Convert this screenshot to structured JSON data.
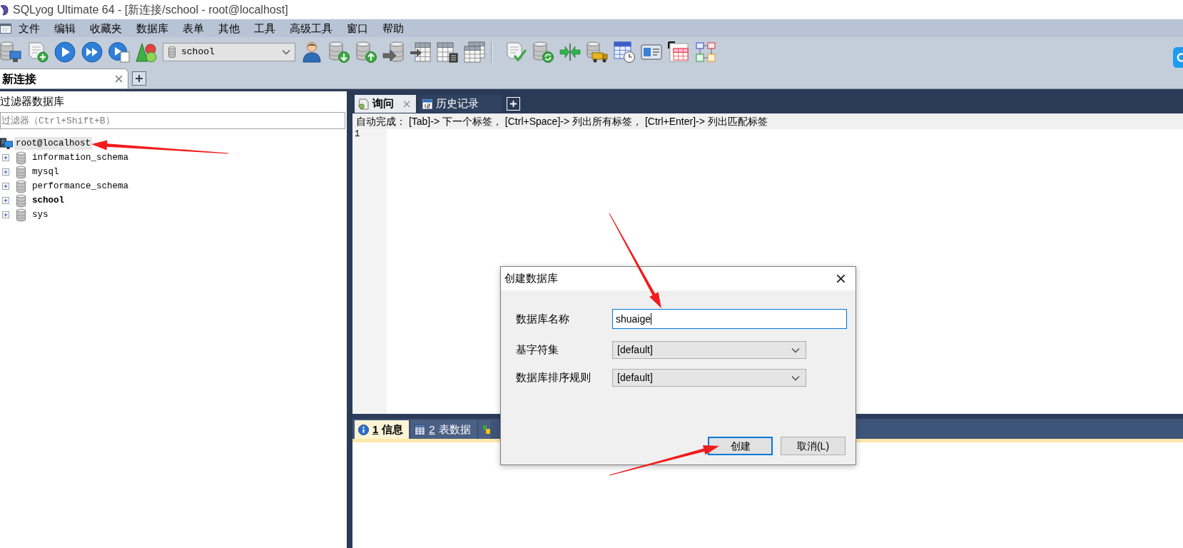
{
  "window": {
    "title": "SQLyog Ultimate 64 - [新连接/school - root@localhost]"
  },
  "menu": [
    "文件",
    "编辑",
    "收藏夹",
    "数据库",
    "表单",
    "其他",
    "工具",
    "高级工具",
    "窗口",
    "帮助"
  ],
  "toolbar": {
    "database": "school"
  },
  "connection_tabs": [
    {
      "label": "新连接",
      "selected": true
    }
  ],
  "object_browser": {
    "title": "过滤器数据库",
    "filter": {
      "placeholder": "过滤器（Ctrl+Shift+B）"
    },
    "tree": [
      {
        "kind": "server",
        "label": "root@localhost",
        "selected": true,
        "children": [
          {
            "kind": "database",
            "label": "information_schema",
            "selected": false,
            "current": false,
            "expanded": false
          },
          {
            "kind": "database",
            "label": "mysql",
            "selected": false,
            "current": false,
            "expanded": false
          },
          {
            "kind": "database",
            "label": "performance_schema",
            "selected": false,
            "current": false,
            "expanded": false
          },
          {
            "kind": "database",
            "label": "school",
            "selected": false,
            "current": true,
            "expanded": false
          },
          {
            "kind": "database",
            "label": "sys",
            "selected": false,
            "current": false,
            "expanded": false
          }
        ]
      }
    ]
  },
  "query_tabs": [
    {
      "kind": "query",
      "label": "询问",
      "selected": true
    },
    {
      "kind": "history",
      "label": "历史记录",
      "selected": false
    }
  ],
  "autocomplete_hint": "自动完成： [Tab]-> 下一个标签， [Ctrl+Space]-> 列出所有标签， [Ctrl+Enter]-> 列出匹配标签",
  "editor": {
    "line_numbers": [
      "1"
    ]
  },
  "result_tabs": [
    {
      "kind": "info",
      "number": "1",
      "label": "信息",
      "selected": true
    },
    {
      "kind": "table",
      "number": "2",
      "label": "表数据",
      "selected": false
    },
    {
      "kind": "other",
      "selected": false
    }
  ],
  "dialog": {
    "title": "创建数据库",
    "fields": [
      {
        "kind": "text",
        "label": "数据库名称",
        "value": "shuaige",
        "focused": true
      },
      {
        "kind": "select",
        "label": "基字符集",
        "value": "[default]"
      },
      {
        "kind": "select",
        "label": "数据库排序规则",
        "value": "[default]"
      }
    ],
    "buttons": [
      {
        "label": "创建",
        "default": true
      },
      {
        "label": "取消(L)",
        "default": false
      }
    ]
  }
}
